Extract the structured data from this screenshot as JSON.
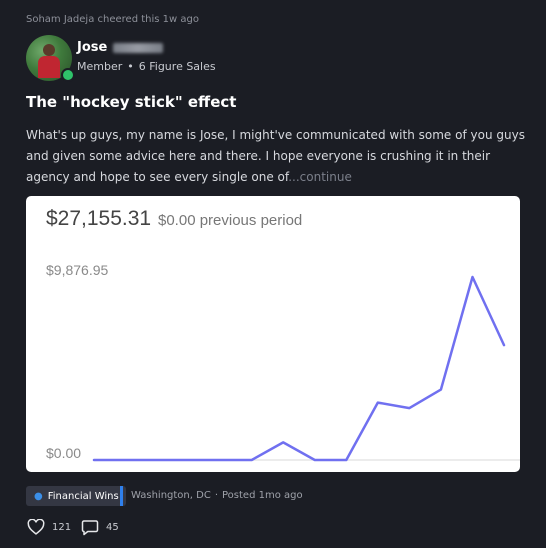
{
  "cheer_line": "Soham Jadeja cheered this 1w ago",
  "author": {
    "first_name": "Jose",
    "role": "Member",
    "badge": "6 Figure Sales",
    "online": true
  },
  "post": {
    "title": "The \"hockey stick\" effect",
    "body": "What's up guys, my name is Jose, I might've communicated with some of you guys and given some advice here and there. I hope everyone is crushing it in their agency and hope to see every single one of",
    "continue_label": "...continue"
  },
  "chart_card": {
    "total": "$27,155.31",
    "previous": "$0.00 previous period",
    "y_top_label": "$9,876.95",
    "y_bottom_label": "$0.00"
  },
  "chart_data": {
    "type": "line",
    "ylim": [
      0,
      9876.95
    ],
    "series": [
      {
        "values": [
          0,
          0,
          0,
          0,
          0,
          0,
          950,
          0,
          0,
          3100,
          2800,
          3800,
          9876.95,
          6200
        ]
      }
    ],
    "color": "#7070f0",
    "grid": false
  },
  "footer": {
    "tag_label": "Financial Wins",
    "location": "Washington, DC",
    "posted": "Posted 1mo ago",
    "like_count": "121",
    "comment_count": "45"
  },
  "colors": {
    "background": "#1b1d24",
    "tag_bar": "#2f80ed",
    "online": "#2fc36a"
  },
  "icons": {
    "tag": "money-bag-icon",
    "like": "heart-icon",
    "comment": "comment-bubble-icon"
  }
}
